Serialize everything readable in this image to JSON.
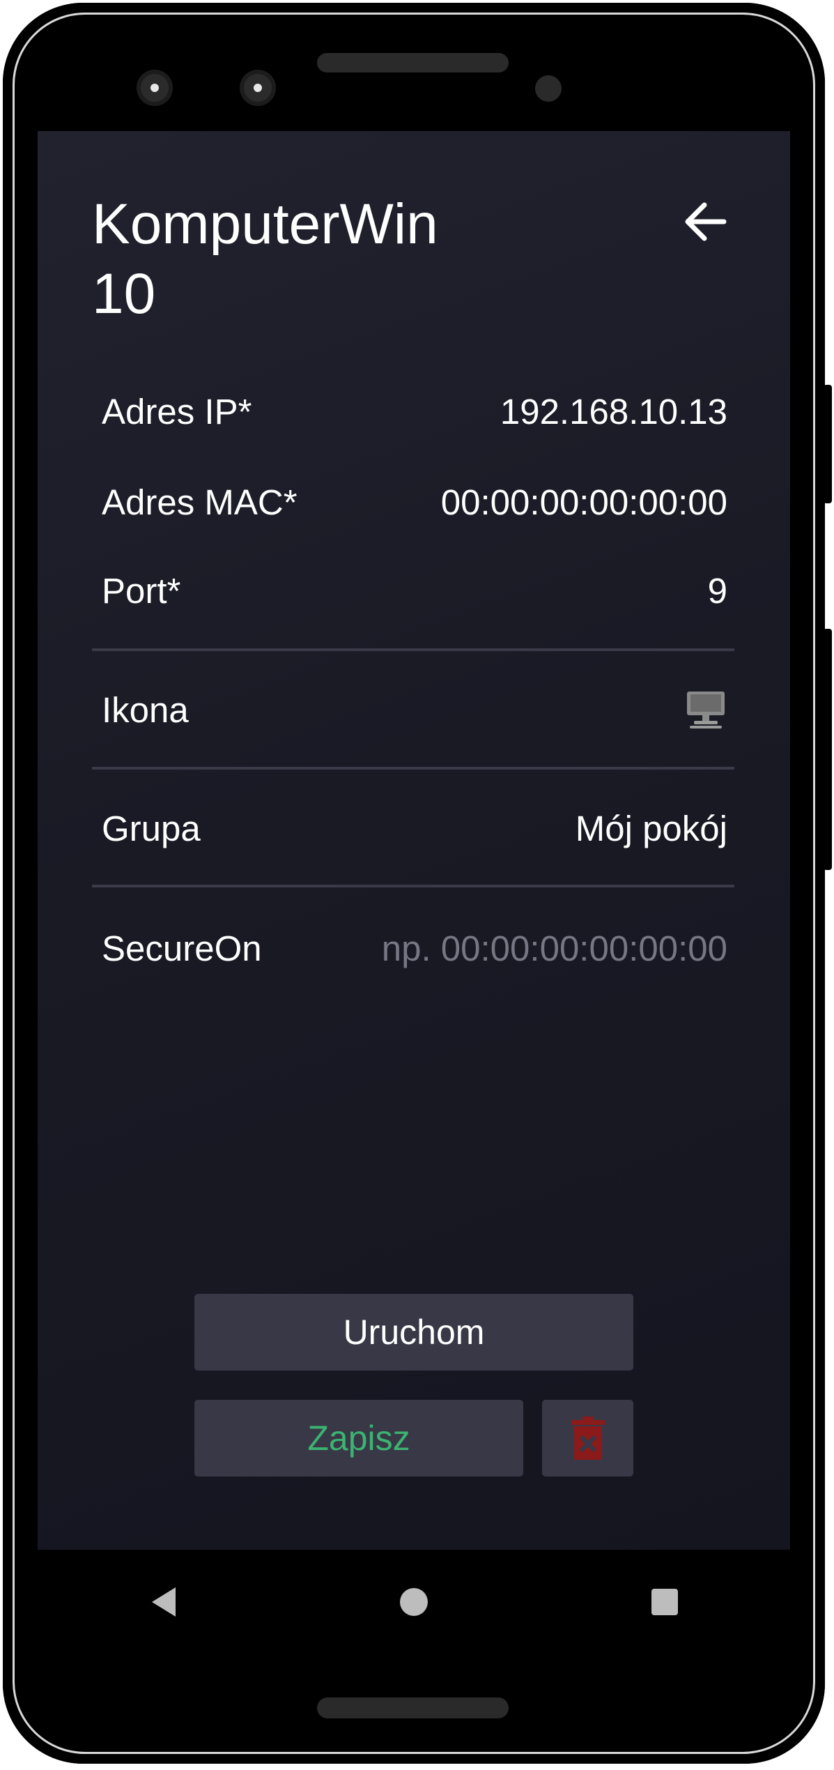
{
  "header": {
    "title": "KomputerWin10",
    "back_icon": "arrow-left-icon"
  },
  "fields": {
    "ip": {
      "label": "Adres IP*",
      "value": "192.168.10.13"
    },
    "mac": {
      "label": "Adres MAC*",
      "value": "00:00:00:00:00:00"
    },
    "port": {
      "label": "Port*",
      "value": "9"
    },
    "icon": {
      "label": "Ikona",
      "value_icon": "desktop-computer-icon"
    },
    "group": {
      "label": "Grupa",
      "value": "Mój pokój"
    },
    "secureon": {
      "label": "SecureOn",
      "placeholder": "np. 00:00:00:00:00:00"
    }
  },
  "actions": {
    "run_label": "Uruchom",
    "save_label": "Zapisz",
    "delete_icon": "trash-icon"
  },
  "navbar": {
    "back_icon": "triangle-back-icon",
    "home_icon": "circle-home-icon",
    "recents_icon": "square-recents-icon"
  },
  "colors": {
    "save_text": "#3cb371",
    "delete_icon": "#8b1a1a",
    "button_bg": "#383847",
    "placeholder": "#777784"
  }
}
